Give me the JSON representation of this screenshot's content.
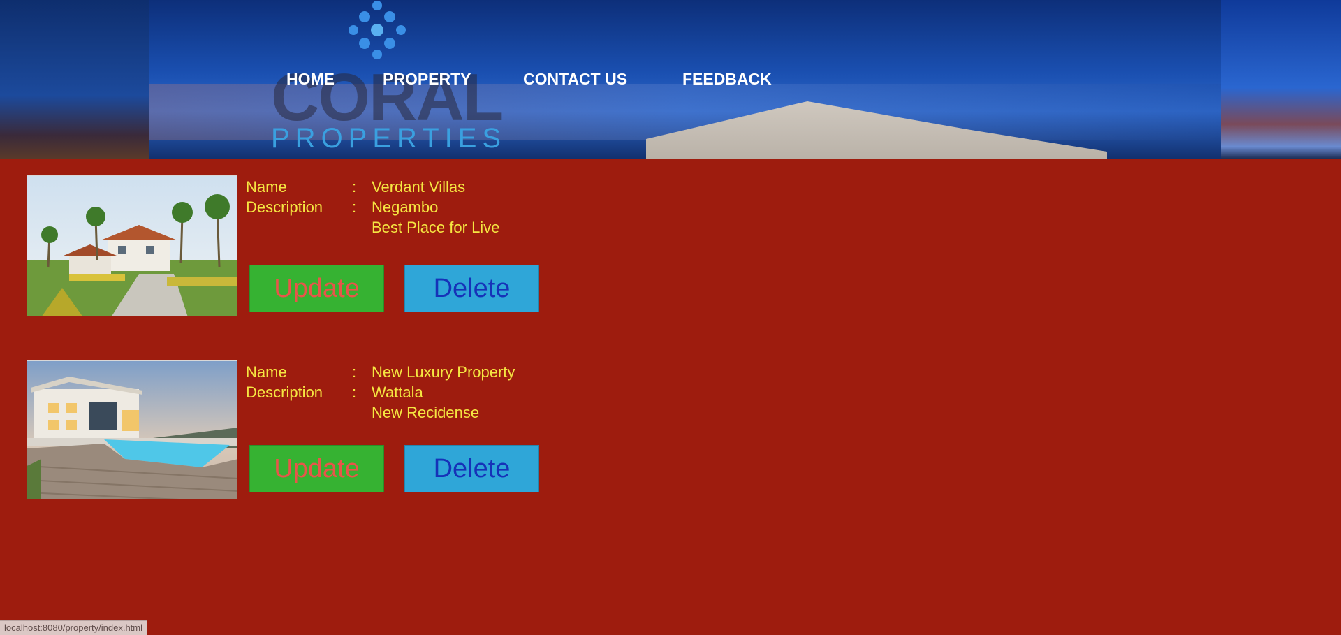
{
  "nav": {
    "items": [
      {
        "label": "HOME"
      },
      {
        "label": "PROPERTY"
      },
      {
        "label": "CONTACT US"
      },
      {
        "label": "FEEDBACK"
      }
    ]
  },
  "logo": {
    "line1": "CORAL",
    "line2": "PROPERTIES",
    "icon": "logo-mark-icon"
  },
  "labels": {
    "name": "Name",
    "description": "Description",
    "colon": ":"
  },
  "properties": [
    {
      "name": "Verdant Villas",
      "description_line1": "Negambo",
      "description_line2": "Best Place for Live",
      "update_label": "Update",
      "delete_label": "Delete"
    },
    {
      "name": "New Luxury Property",
      "description_line1": "Wattala",
      "description_line2": "New Recidense",
      "update_label": "Update",
      "delete_label": "Delete"
    }
  ],
  "status_bar": {
    "url": "localhost:8080/property/index.html"
  },
  "colors": {
    "page_background": "#9e1c0e",
    "text_yellow": "#f5e642",
    "update_green": "#36b232",
    "delete_blue": "#2fa6d8"
  }
}
